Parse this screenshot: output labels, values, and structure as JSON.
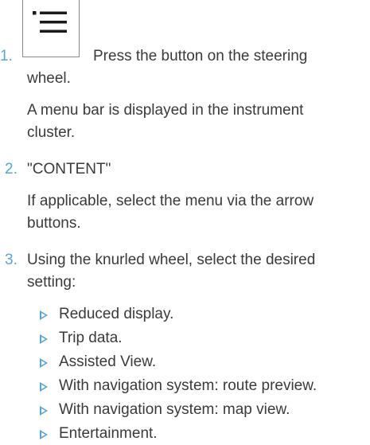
{
  "steps": [
    {
      "number": "1.",
      "icon": "menu-list-icon",
      "line1": "Press the button on the steering",
      "line2": "wheel.",
      "note_line1": "A menu bar is displayed in the instrument",
      "note_line2": "cluster."
    },
    {
      "number": "2.",
      "line1": "\"CONTENT\"",
      "note_line1": "If applicable, select the menu via the arrow",
      "note_line2": "buttons."
    },
    {
      "number": "3.",
      "line1": "Using the knurled wheel, select the desired",
      "line2": "setting:",
      "options": [
        "Reduced display.",
        "Trip data.",
        "Assisted View.",
        "With navigation system: route preview.",
        "With navigation system: map view.",
        "Entertainment."
      ]
    }
  ],
  "colors": {
    "accent": "#5aa4cf",
    "text": "#3a3a3a"
  }
}
